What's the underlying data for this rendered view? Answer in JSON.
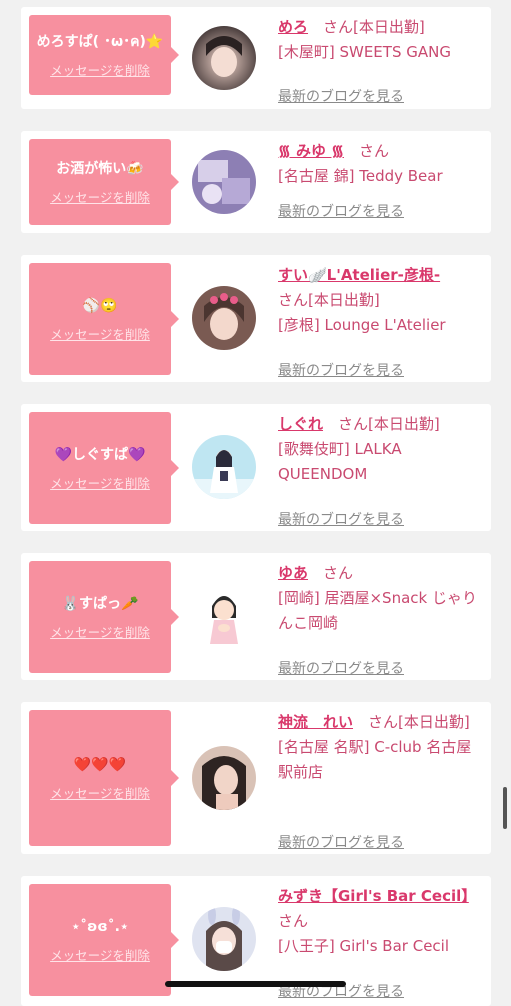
{
  "delete_label": "メッセージを削除",
  "blog_label": "最新のブログを見る",
  "san_label": "さん",
  "cards": [
    {
      "message": "めろすぱ( ･ω･ค)⭐️",
      "name": "めろ",
      "status": "[本日出勤]",
      "shop": "[木屋町] SWEETS GANG"
    },
    {
      "message": "お酒が怖い🍻",
      "name": "᯾ みゆ ᯾",
      "status": "",
      "shop": "[名古屋 錦] Teddy Bear"
    },
    {
      "message": "⚾️🙄",
      "name": "すい🪽L'Atelier-彦根-",
      "status": "[本日出勤]",
      "shop": "[彦根] Lounge L'Atelier"
    },
    {
      "message": "💜しぐすぱ💜",
      "name": "しぐれ",
      "status": "[本日出勤]",
      "shop": "[歌舞伎町] LALKA QUEENDOM"
    },
    {
      "message": "🐰すぱっ🥕",
      "name": "ゆあ",
      "status": "",
      "shop": "[岡崎] 居酒屋×Snack じゃりんこ岡崎"
    },
    {
      "message": "❤️❤️❤️",
      "name": "神流　れい",
      "status": "[本日出勤]",
      "shop": "[名古屋 名駅] C-club 名古屋駅前店"
    },
    {
      "message": "⋆˚ʚɞ˚.⋆",
      "name": "みずき【Girl's Bar Cecil】",
      "status": "",
      "shop": "[八王子] Girl's Bar Cecil"
    }
  ],
  "colors": {
    "accent": "#f7909f",
    "name": "#d9386b",
    "text": "#c94a70",
    "link_gray": "#8a8a8a",
    "background": "#f1f1f1"
  }
}
